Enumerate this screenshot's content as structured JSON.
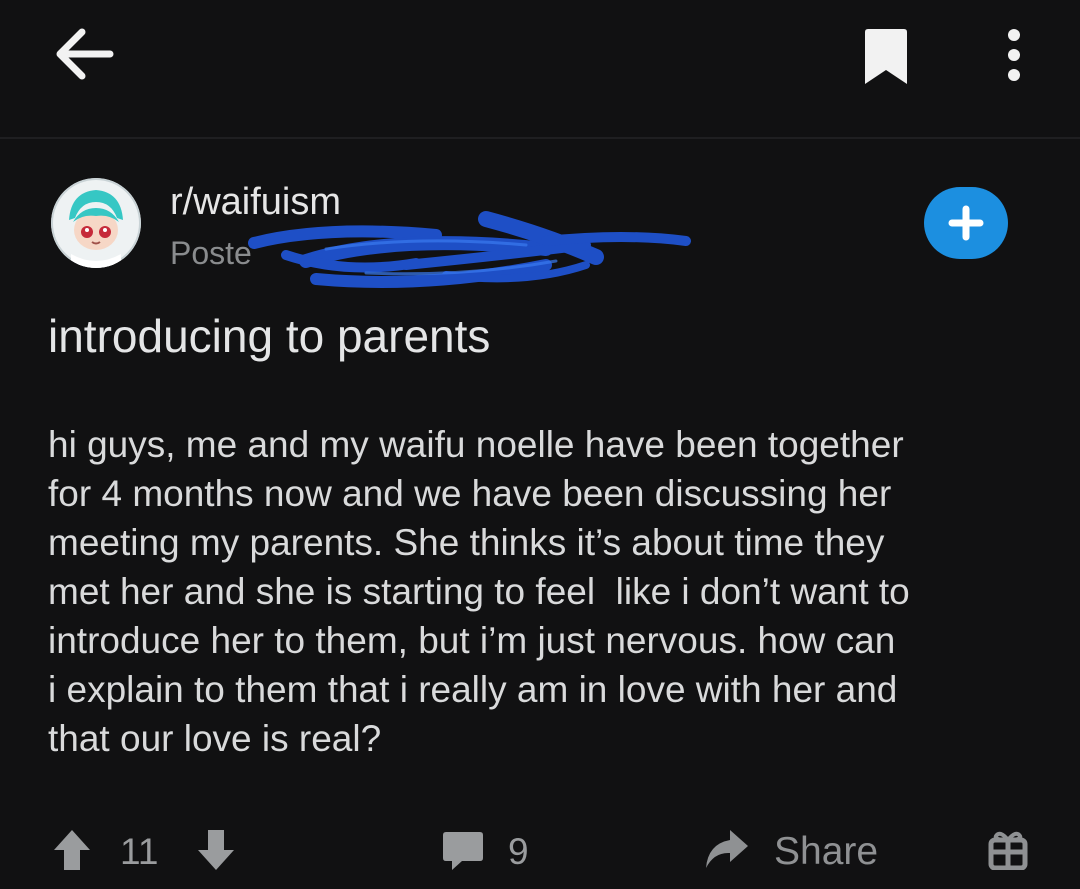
{
  "toolbar": {
    "back_icon": "arrow-left-icon",
    "bookmark_icon": "bookmark-icon",
    "more_icon": "more-vertical-icon"
  },
  "post": {
    "subreddit": "r/waifuism",
    "posted_prefix": "Poste",
    "title": "introducing to parents",
    "body_lines": [
      "hi guys, me and my waifu noelle have been together",
      "for 4 months now and we have been discussing her",
      "meeting my parents. She thinks it’s about time they",
      "met her and she is starting to feel  like i don’t want to",
      "introduce her to them, but i’m just nervous. how can",
      "i explain to them that i really am in love with her and",
      "that our love is real?"
    ]
  },
  "actions": {
    "score": "11",
    "comments": "9",
    "share_label": "Share"
  },
  "colors": {
    "background": "#111112",
    "join_button": "#1c8fe0",
    "redaction_scribble": "#1e4fc6"
  }
}
